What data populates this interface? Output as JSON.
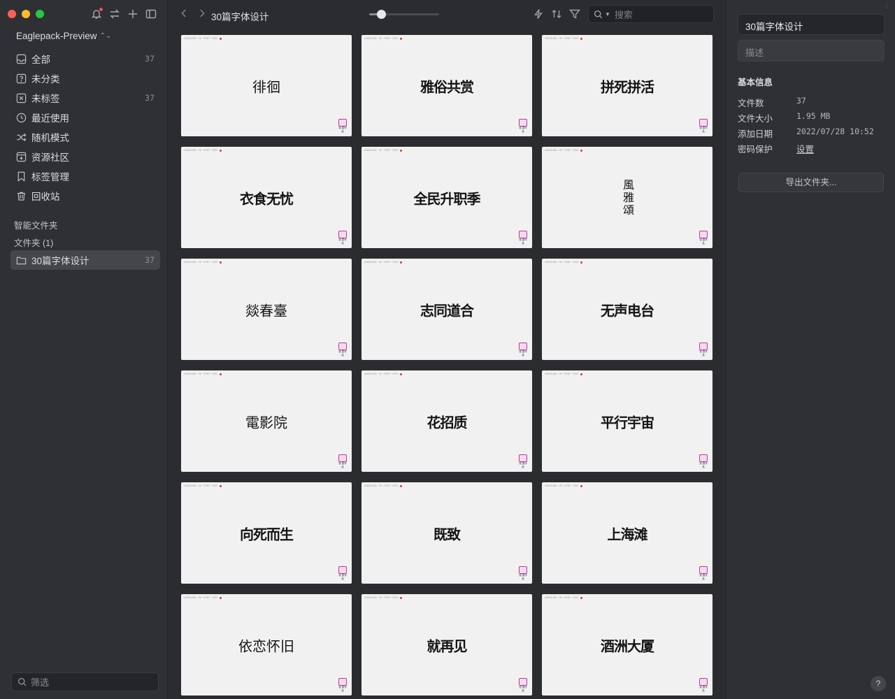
{
  "sidebar": {
    "library_name": "Eaglepack-Preview",
    "library_switch_glyph": "⌃⌄",
    "nav": [
      {
        "icon": "inbox-icon",
        "label": "全部",
        "count": "37"
      },
      {
        "icon": "question-icon",
        "label": "未分类",
        "count": ""
      },
      {
        "icon": "untagged-icon",
        "label": "未标签",
        "count": "37"
      },
      {
        "icon": "clock-icon",
        "label": "最近使用",
        "count": ""
      },
      {
        "icon": "shuffle-icon",
        "label": "随机模式",
        "count": ""
      },
      {
        "icon": "community-icon",
        "label": "资源社区",
        "count": ""
      },
      {
        "icon": "tag-icon",
        "label": "标签管理",
        "count": ""
      },
      {
        "icon": "trash-icon",
        "label": "回收站",
        "count": ""
      }
    ],
    "smart_folders_label": "智能文件夹",
    "folders_label": "文件夹 (1)",
    "folder": {
      "label": "30篇字体设计",
      "count": "37"
    },
    "filter_placeholder": "筛选"
  },
  "toolbar": {
    "title": "30篇字体设计",
    "zoom_fraction": 0.17,
    "search_placeholder": "搜索"
  },
  "grid": {
    "card_meta": "UNSOUND · 26 · FONT · 2022",
    "logo_label": "钱 童作品",
    "items": [
      {
        "text": "徘徊",
        "style": "thin"
      },
      {
        "text": "雅俗共赏",
        "style": "bold"
      },
      {
        "text": "拼死拼活",
        "style": "bold"
      },
      {
        "text": "衣食无忧",
        "style": "bold"
      },
      {
        "text": "全民升职季",
        "style": "bold"
      },
      {
        "text": "風雅頌",
        "style": "vertical"
      },
      {
        "text": "燚春臺",
        "style": "thin"
      },
      {
        "text": "志同道合",
        "style": "bold"
      },
      {
        "text": "无声电台",
        "style": "bold"
      },
      {
        "text": "電影院",
        "style": "thin"
      },
      {
        "text": "花招质",
        "style": "bold"
      },
      {
        "text": "平行宇宙",
        "style": "bold"
      },
      {
        "text": "向死而生",
        "style": "bold"
      },
      {
        "text": "既致",
        "style": "bold"
      },
      {
        "text": "上海滩",
        "style": "bold"
      },
      {
        "text": "依恋怀旧",
        "style": "thin"
      },
      {
        "text": "就再见",
        "style": "bold"
      },
      {
        "text": "酒洲大厦",
        "style": "bold"
      }
    ]
  },
  "inspector": {
    "title": "30篇字体设计",
    "description_placeholder": "描述",
    "section": "基本信息",
    "rows": [
      {
        "key": "文件数",
        "value": "37"
      },
      {
        "key": "文件大小",
        "value": "1.95 MB"
      },
      {
        "key": "添加日期",
        "value": "2022/07/28 10:52"
      },
      {
        "key": "密码保护",
        "value": "设置"
      }
    ],
    "export_label": "导出文件夹...",
    "help_label": "?"
  },
  "colors": {
    "sidebar_bg": "#2f3034",
    "main_bg": "#2b2c30",
    "active_item": "#45464b",
    "notification": "#ff4d4f"
  }
}
